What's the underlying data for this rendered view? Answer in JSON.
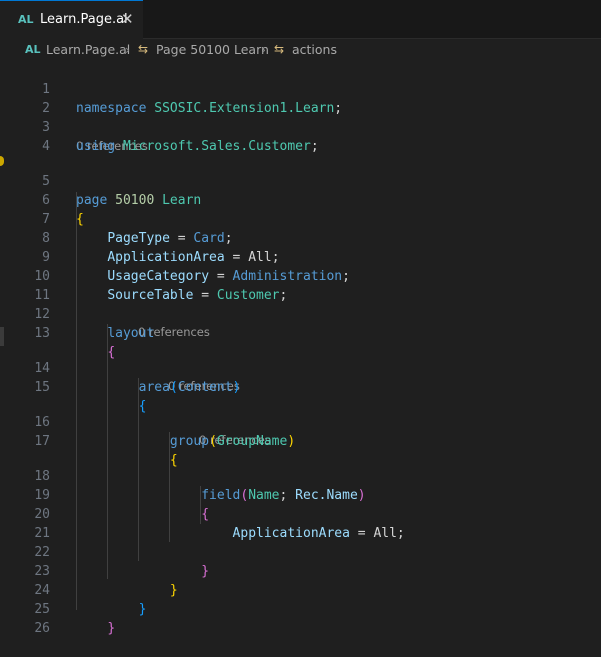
{
  "tab": {
    "lang_badge": "AL",
    "title": "Learn.Page.al",
    "close_glyph": "✕"
  },
  "breadcrumb": {
    "badge": "AL",
    "file": "Learn.Page.al",
    "separator": "›",
    "symbol_glyph": "⇆",
    "items": [
      "Page 50100 Learn",
      "actions"
    ]
  },
  "codelens": {
    "text": "0 references"
  },
  "code": {
    "line_numbers": [
      "1",
      "2",
      "3",
      "4",
      "5",
      "6",
      "7",
      "8",
      "9",
      "10",
      "11",
      "12",
      "13",
      "14",
      "15",
      "16",
      "17",
      "18",
      "19",
      "20",
      "21",
      "22",
      "23",
      "24",
      "25",
      "26"
    ],
    "namespace_kw": "namespace",
    "namespace_name": "SSOSIC.Extension1.Learn",
    "using_kw": "using",
    "using_name": "Microsoft.Sales.Customer",
    "page_kw": "page",
    "page_id": "50100",
    "page_name": "Learn",
    "prop_pagetype": "PageType",
    "val_pagetype": "Card",
    "prop_apparea": "ApplicationArea",
    "val_apparea": "All",
    "prop_usage": "UsageCategory",
    "val_usage": "Administration",
    "prop_source": "SourceTable",
    "val_source": "Customer",
    "layout_kw": "layout",
    "area_kw": "area",
    "area_arg": "Content",
    "group_kw": "group",
    "group_arg": "GroupName",
    "field_kw": "field",
    "field_arg1": "Name",
    "field_arg2": "Rec.Name",
    "prop_apparea2": "ApplicationArea",
    "val_apparea2": "All",
    "eq": "=",
    "semi": ";",
    "open_brace": "{",
    "close_brace": "}",
    "open_paren": "(",
    "close_paren": ")"
  },
  "colors": {
    "background": "#1f1f1f",
    "keyword": "#569cd6",
    "type": "#4ec9b0",
    "identifier": "#9cdcfe",
    "number": "#b5cea8",
    "function": "#dcdcaa",
    "bracket_gold": "#ffd700",
    "bracket_pink": "#da70d6",
    "bracket_blue": "#179fff"
  }
}
